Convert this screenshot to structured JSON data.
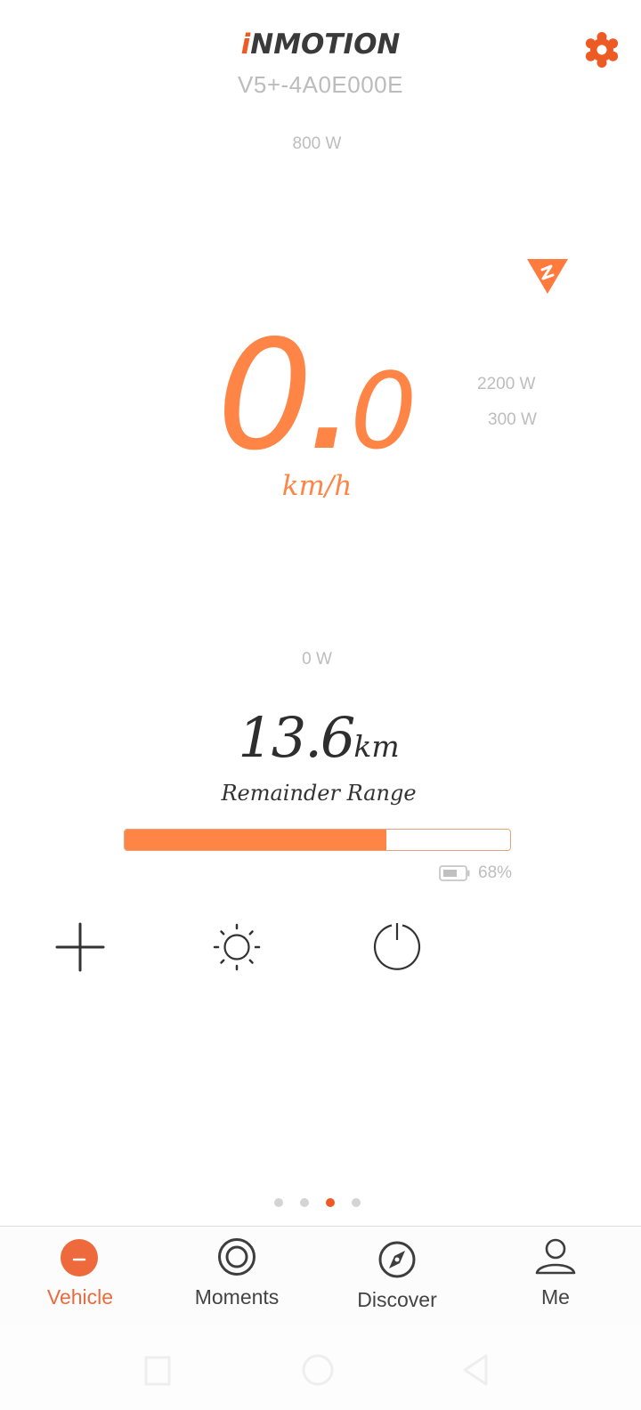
{
  "header": {
    "brand_prefix": "i",
    "brand_name": "NMOTION",
    "device_name": "V5+-4A0E000E",
    "settings_icon": "gear-icon"
  },
  "gauge": {
    "labels": {
      "top": "800 W",
      "bottom": "0 W",
      "right_upper": "2200 W",
      "right_lower": "300 W"
    },
    "marker_icon": "triangle-z-marker-icon",
    "speed_integer": "0",
    "speed_separator": ".",
    "speed_decimal": "0",
    "speed_unit": "km/h"
  },
  "range": {
    "value": "13.6",
    "unit": "km",
    "label": "Remainder Range",
    "battery_fraction": 0.68,
    "battery_text": "68%"
  },
  "controls": [
    {
      "name": "add",
      "icon": "plus-icon"
    },
    {
      "name": "light",
      "icon": "sun-icon"
    },
    {
      "name": "power",
      "icon": "power-icon"
    }
  ],
  "pager": {
    "count": 4,
    "active_index": 2
  },
  "tabs": [
    {
      "label": "Vehicle",
      "icon": "vehicle-icon",
      "active": true
    },
    {
      "label": "Moments",
      "icon": "moments-icon",
      "active": false
    },
    {
      "label": "Discover",
      "icon": "compass-icon",
      "active": false
    },
    {
      "label": "Me",
      "icon": "person-icon",
      "active": false
    }
  ],
  "system_nav": [
    "recents",
    "home",
    "back"
  ],
  "colors": {
    "accent": "#ff8547",
    "brand_red": "#ee5a24",
    "text_dark": "#333333",
    "label_gray": "#bdbdbd"
  }
}
